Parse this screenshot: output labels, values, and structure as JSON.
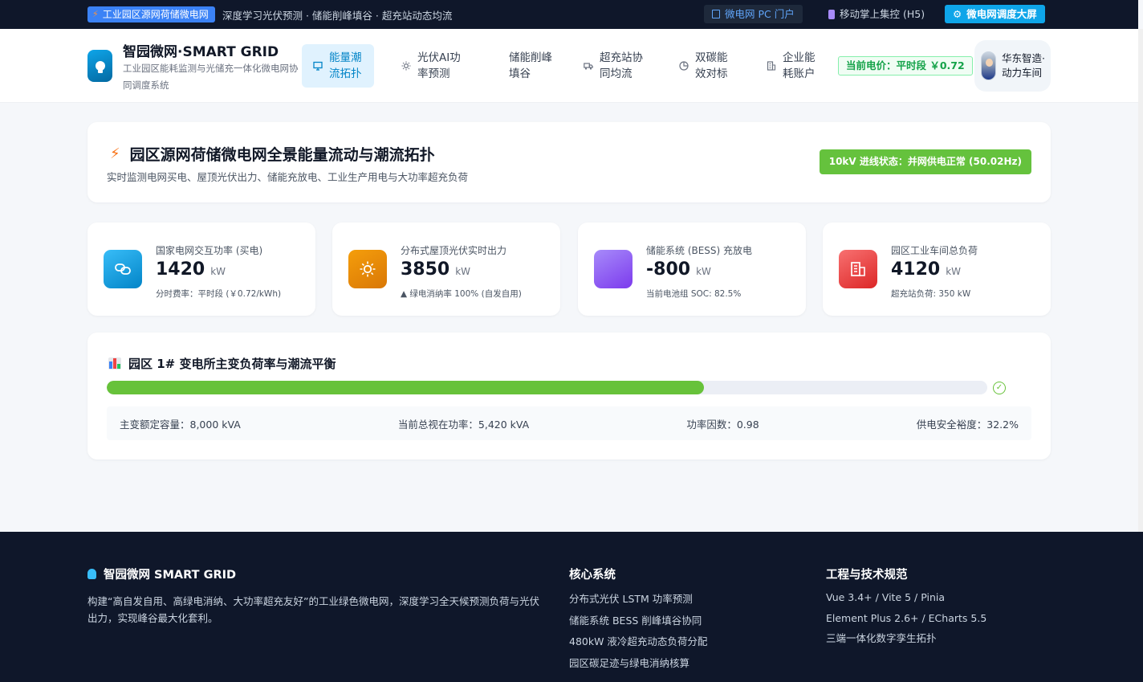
{
  "topbar": {
    "badge": "工业园区源网荷储微电网",
    "slogan": "深度学习光伏预测 · 储能削峰填谷 · 超充站动态均流",
    "pc_portal": "微电网 PC 门户",
    "mobile": "移动掌上集控 (H5)",
    "big_screen": "微电网调度大屏"
  },
  "header": {
    "brand_title": "智园微网·SMART GRID",
    "brand_subtitle": "工业园区能耗监测与光储充一体化微电网协同调度系统",
    "nav": [
      {
        "label": "能量潮流拓扑",
        "icon": "monitor-icon",
        "active": true
      },
      {
        "label": "光伏AI功率预测",
        "icon": "sun-icon",
        "active": false
      },
      {
        "label": "储能削峰填谷",
        "icon": "",
        "active": false
      },
      {
        "label": "超充站协同均流",
        "icon": "truck-icon",
        "active": false
      },
      {
        "label": "双碳能效对标",
        "icon": "pie-chart-icon",
        "active": false
      },
      {
        "label": "企业能耗账户",
        "icon": "office-building-icon",
        "active": false
      }
    ],
    "price_tag": "当前电价：平时段 ￥0.72",
    "user_name": "华东智造·动力车间"
  },
  "hero": {
    "title": "园区源网荷储微电网全景能量流动与潮流拓扑",
    "subtitle": "实时监测电网买电、屋顶光伏出力、储能充放电、工业生产用电与大功率超充负荷",
    "status": "10kV 进线状态：并网供电正常 (50.02Hz)"
  },
  "kpis": [
    {
      "label": "国家电网交互功率 (买电)",
      "value": "1420",
      "unit": "kW",
      "note": "分时费率：平时段 (￥0.72/kWh)",
      "icon": "link-icon",
      "color": "#0ea5e9"
    },
    {
      "label": "分布式屋顶光伏实时出力",
      "value": "3850",
      "unit": "kW",
      "note": "▲ 绿电消纳率 100% (自发自用)",
      "icon": "sun-icon",
      "color": "#f59e0b"
    },
    {
      "label": "储能系统 (BESS) 充放电",
      "value": "-800",
      "unit": "kW",
      "note": "当前电池组 SOC: 82.5%",
      "icon": "battery-icon",
      "color": "#8b5cf6"
    },
    {
      "label": "园区工业车间总负荷",
      "value": "4120",
      "unit": "kW",
      "note": "超充站负荷: 350 kW",
      "icon": "factory-icon",
      "color": "#ef4444"
    }
  ],
  "transformer": {
    "title": "园区 1# 变电所主变负荷率与潮流平衡",
    "load_ratio": 0.678,
    "rated": "主变额定容量：8,000 kVA",
    "apparent": "当前总视在功率：5,420 kVA",
    "power_factor": "功率因数：0.98",
    "margin": "供电安全裕度：32.2%"
  },
  "footer": {
    "brand": "智园微网 SMART GRID",
    "description": "构建“高自发自用、高绿电消纳、大功率超充友好”的工业绿色微电网，深度学习全天候预测负荷与光伏出力，实现峰谷最大化套利。",
    "core_title": "核心系统",
    "core_items": [
      "分布式光伏 LSTM 功率预测",
      "储能系统 BESS 削峰填谷协同",
      "480kW 液冷超充动态负荷分配",
      "园区碳足迹与绿电消纳核算"
    ],
    "tech_title": "工程与技术规范",
    "tech_items": [
      "Vue 3.4+ / Vite 5 / Pinia",
      "Element Plus 2.6+ / ECharts 5.5",
      "三端一体化数字孪生拓扑"
    ]
  }
}
